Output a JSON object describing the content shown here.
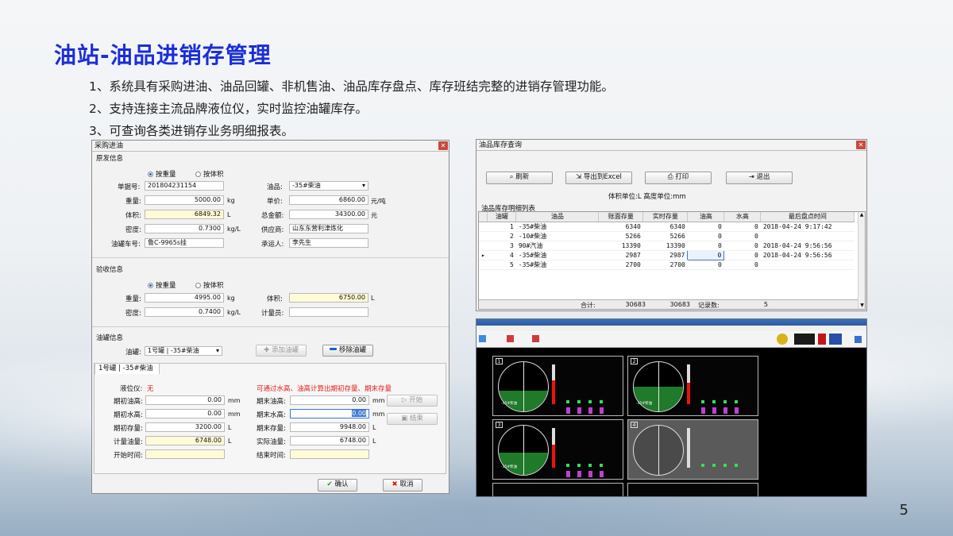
{
  "slide": {
    "title": "油站-油品进销存管理",
    "bullets": [
      "1、系统具有采购进油、油品回罐、非机售油、油品库存盘点、库存班结完整的进销存管理功能。",
      "2、支持连接主流品牌液位仪，实时监控油罐库存。",
      "3、可查询各类进销存业务明细报表。"
    ],
    "page_number": "5"
  },
  "purchase_window": {
    "title": "采购进油",
    "source_section": "原发信息",
    "radio_weight": "按重量",
    "radio_volume": "按体积",
    "labels": {
      "order_no": "单据号:",
      "weight": "重量:",
      "volume": "体积:",
      "density": "密度:",
      "truck_no": "油罐车号:",
      "oil": "油品:",
      "unit_price": "单价:",
      "total_amount": "总金额:",
      "supplier": "供应商:",
      "carrier": "承运人:"
    },
    "values": {
      "order_no": "201804231154",
      "weight": "5000.00",
      "volume": "6849.32",
      "density": "0.7300",
      "truck_no": "鲁C-9965s挂",
      "oil": "-35#柴油",
      "unit_price": "6860.00",
      "total_amount": "34300.00",
      "supplier": "山东东营利津炼化",
      "carrier": "李先生"
    },
    "units": {
      "kg": "kg",
      "L": "L",
      "kgL": "kg/L",
      "price": "元/吨",
      "yuan": "元"
    },
    "check_section": "验收信息",
    "check_labels": {
      "weight": "重量:",
      "density": "密度:",
      "volume": "体积:",
      "meter": "计量员:"
    },
    "check_values": {
      "weight": "4995.00",
      "density": "0.7400",
      "volume": "6750.00",
      "meter": ""
    },
    "tank_section": "油罐信息",
    "tank_label": "油罐:",
    "tank_value": "1号罐 | -35#柴油",
    "add_tank": "添加油罐",
    "remove_tank": "移除油罐",
    "tab_label": "1号罐 | -35#柴油",
    "gauge_label": "液位仪:",
    "gauge_value": "无",
    "gauge_note": "可通过水高、油高计算出期初存量、期末存量",
    "tab_labels": {
      "start_oil": "期初油高:",
      "start_water": "期初水高:",
      "start_stock": "期初存量:",
      "calc_oil": "计量油量:",
      "start_time": "开始时间:",
      "end_oil": "期末油高:",
      "end_water": "期末水高:",
      "end_stock": "期末存量:",
      "actual_oil": "实际油量:",
      "end_time": "结束时间:"
    },
    "tab_values": {
      "start_oil": "0.00",
      "start_water": "0.00",
      "start_stock": "3200.00",
      "calc_oil": "6748.00",
      "start_time": "",
      "end_oil": "0.00",
      "end_water": "0.00",
      "end_stock": "9948.00",
      "actual_oil": "6748.00",
      "end_time": ""
    },
    "unit_mm": "mm",
    "start_btn": "开始",
    "end_btn": "结束",
    "ok_btn": "确认",
    "cancel_btn": "取消"
  },
  "stock_window": {
    "title": "油品库存查询",
    "refresh": "刷新",
    "export": "导出到Excel",
    "print": "打印",
    "exit": "退出",
    "units_note": "体积单位:L  高度单位:mm",
    "list_title": "油品库存明细列表",
    "columns": [
      "油罐",
      "油品",
      "账面存量",
      "实时存量",
      "油高",
      "水高",
      "最后盘点时间"
    ],
    "rows": [
      [
        "1",
        "-35#柴油",
        "6340",
        "6340",
        "0",
        "0",
        "2018-04-24 9:17:42"
      ],
      [
        "2",
        "-10#柴油",
        "5266",
        "5266",
        "0",
        "0",
        ""
      ],
      [
        "3",
        "90#汽油",
        "13390",
        "13390",
        "0",
        "0",
        "2018-04-24 9:56:56"
      ],
      [
        "4",
        "-35#柴油",
        "2987",
        "2987",
        "0",
        "0",
        "2018-04-24 9:56:56"
      ],
      [
        "5",
        "-35#柴油",
        "2700",
        "2700",
        "0",
        "0",
        ""
      ]
    ],
    "total_label": "合计:",
    "total_book": "30683",
    "total_real": "30683",
    "count_label": "记录数:",
    "count_value": "5"
  },
  "monitor_window": {
    "tanks": [
      {
        "no": "1",
        "oil": "-35#柴油",
        "level": 0.42
      },
      {
        "no": "2",
        "oil": "-35#柴油",
        "level": 0.5
      },
      {
        "no": "3",
        "oil": "-35#柴油",
        "level": 0.45
      },
      {
        "no": "4",
        "oil": "",
        "level": 0.0
      }
    ]
  }
}
